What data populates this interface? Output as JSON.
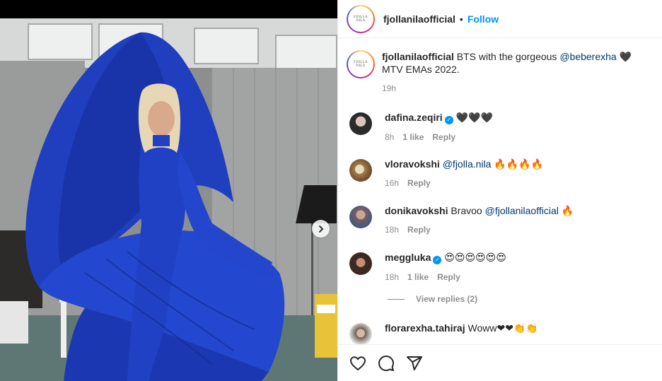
{
  "post": {
    "username": "fjollanilaofficial",
    "follow_label": "Follow",
    "dot": "•",
    "logo_line1": "FJOLLA",
    "logo_line2": "NILA",
    "caption_prefix": "BTS with the gorgeous ",
    "caption_mention": "@beberexha",
    "caption_suffix": " 🖤 MTV EMAs 2022.",
    "caption_time": "19h"
  },
  "comments": [
    {
      "username": "dafina.zeqiri",
      "verified": true,
      "text": " 🖤🖤🖤",
      "time": "8h",
      "likes": "1 like",
      "reply": "Reply",
      "avatar_color": "#3a3a3a"
    },
    {
      "username": "vloravokshi",
      "verified": false,
      "mention": "@fjolla.nila",
      "text": " 🔥🔥🔥🔥",
      "time": "16h",
      "reply": "Reply",
      "avatar_color": "#b08a55"
    },
    {
      "username": "donikavokshi",
      "verified": false,
      "prefix": " Bravoo ",
      "mention": "@fjollanilaofficial",
      "text": " 🔥",
      "time": "18h",
      "reply": "Reply",
      "avatar_color": "#8a6f7a"
    },
    {
      "username": "meggluka",
      "verified": true,
      "text": " 😍😍😍😍😍😍",
      "time": "18h",
      "likes": "1 like",
      "reply": "Reply",
      "avatar_color": "#5a4035"
    },
    {
      "username": "florarexha.tahiraj",
      "verified": false,
      "text": " Woww❤❤👏👏",
      "avatar_color": "#6b5d52"
    }
  ],
  "view_replies": "View replies (2)",
  "icons": {
    "like": "heart-icon",
    "comment": "comment-icon",
    "share": "share-icon",
    "next": "chevron-right-icon"
  }
}
